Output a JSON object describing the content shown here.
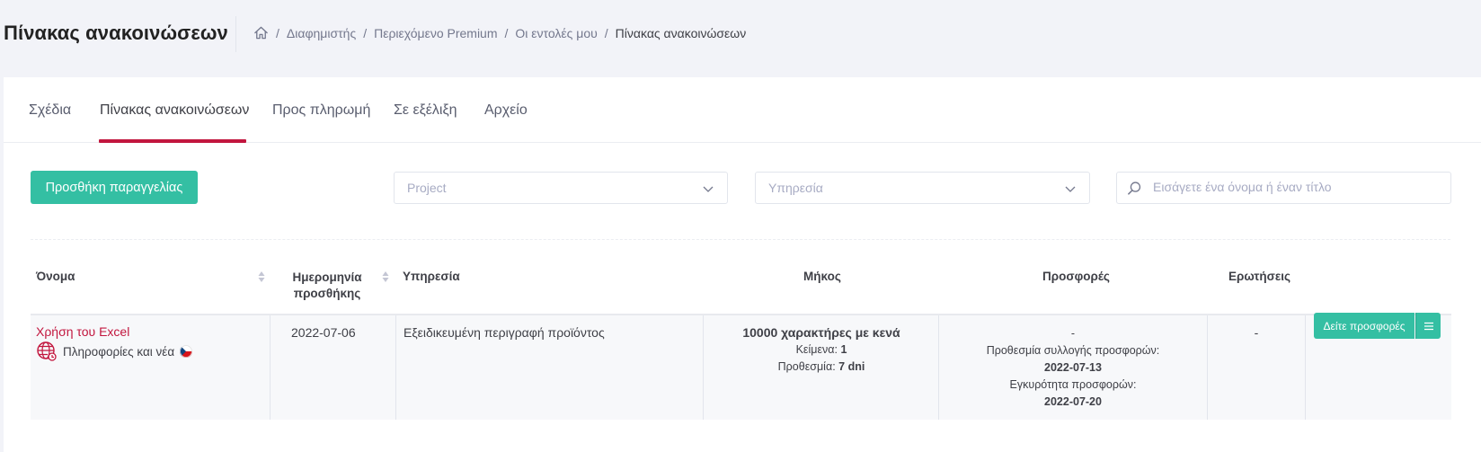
{
  "header": {
    "title": "Πίνακας ανακοινώσεων",
    "breadcrumb": {
      "home_icon": "home-icon",
      "items": [
        "Διαφημιστής",
        "Περιεχόμενο Premium",
        "Οι εντολές μου",
        "Πίνακας ανακοινώσεων"
      ]
    }
  },
  "tabs": [
    {
      "label": "Σχέδια",
      "active": false
    },
    {
      "label": "Πίνακας ανακοινώσεων",
      "active": true
    },
    {
      "label": "Προς πληρωμή",
      "active": false
    },
    {
      "label": "Σε εξέλιξη",
      "active": false
    },
    {
      "label": "Αρχείο",
      "active": false
    }
  ],
  "toolbar": {
    "add_order_label": "Προσθήκη παραγγελίας",
    "project_placeholder": "Project",
    "service_placeholder": "Υπηρεσία",
    "search_placeholder": "Εισάγετε ένα όνομα ή έναν τίτλο"
  },
  "table": {
    "columns": [
      "Όνομα",
      "Ημερομηνία προσθήκης",
      "Υπηρεσία",
      "Μήκος",
      "Προσφορές",
      "Ερωτήσεις"
    ],
    "column_date_line1": "Ημερομηνία",
    "column_date_line2": "προσθήκης",
    "rows": [
      {
        "name": "Χρήση του Excel",
        "category": "Πληροφορίες και νέα",
        "date": "2022-07-06",
        "service": "Εξειδικευμένη περιγραφή προϊόντος",
        "length_title": "10000 χαρακτήρες με κενά",
        "texts_label": "Κείμενα:",
        "texts_value": "1",
        "deadline_label": "Προθεσμία:",
        "deadline_value": "7 dni",
        "offers_count": "-",
        "offer_deadline_label": "Προθεσμία συλλογής προσφορών:",
        "offer_deadline_value": "2022-07-13",
        "offer_validity_label": "Εγκυρότητα προσφορών:",
        "offer_validity_value": "2022-07-20",
        "questions": "-",
        "view_offers_label": "Δείτε προσφορές"
      }
    ]
  },
  "colors": {
    "accent": "#34bfa3",
    "brand_red": "#c2163e"
  }
}
